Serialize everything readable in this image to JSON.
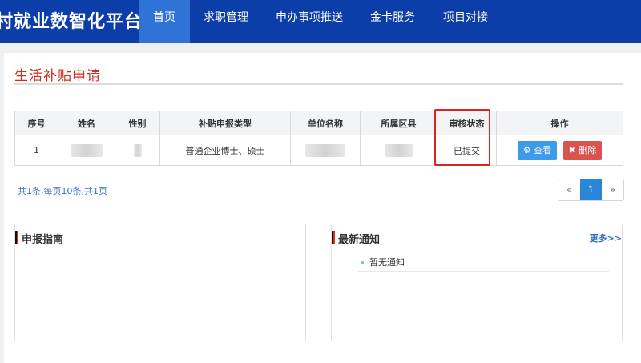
{
  "header": {
    "brand": "村就业数智化平台",
    "nav": [
      {
        "label": "首页",
        "active": true
      },
      {
        "label": "求职管理",
        "active": false
      },
      {
        "label": "申办事项推送",
        "active": false
      },
      {
        "label": "金卡服务",
        "active": false
      },
      {
        "label": "项目对接",
        "active": false
      }
    ]
  },
  "page": {
    "title": "生活补贴申请"
  },
  "table": {
    "headers": [
      "序号",
      "姓名",
      "性别",
      "补贴申报类型",
      "单位名称",
      "所属区县",
      "审核状态",
      "操作"
    ],
    "rows": [
      {
        "index": "1",
        "subsidy_type": "普通企业博士、硕士",
        "status": "已提交"
      }
    ],
    "actions": {
      "view": "查看",
      "delete": "删除"
    }
  },
  "pagination": {
    "summary": "共1条,每页10条,共1页",
    "prev": "«",
    "current": "1",
    "next": "»"
  },
  "guide": {
    "title": "申报指南"
  },
  "news": {
    "title": "最新通知",
    "more": "更多>>",
    "items": [
      "暂无通知"
    ]
  },
  "colors": {
    "header_bg": "#0b3ea8",
    "nav_active": "#2f73d6",
    "accent_red": "#d42b1e",
    "view_btn": "#3e9be9",
    "delete_btn": "#d9534f"
  },
  "icons": {
    "view": "gear-icon",
    "delete": "close-icon"
  }
}
